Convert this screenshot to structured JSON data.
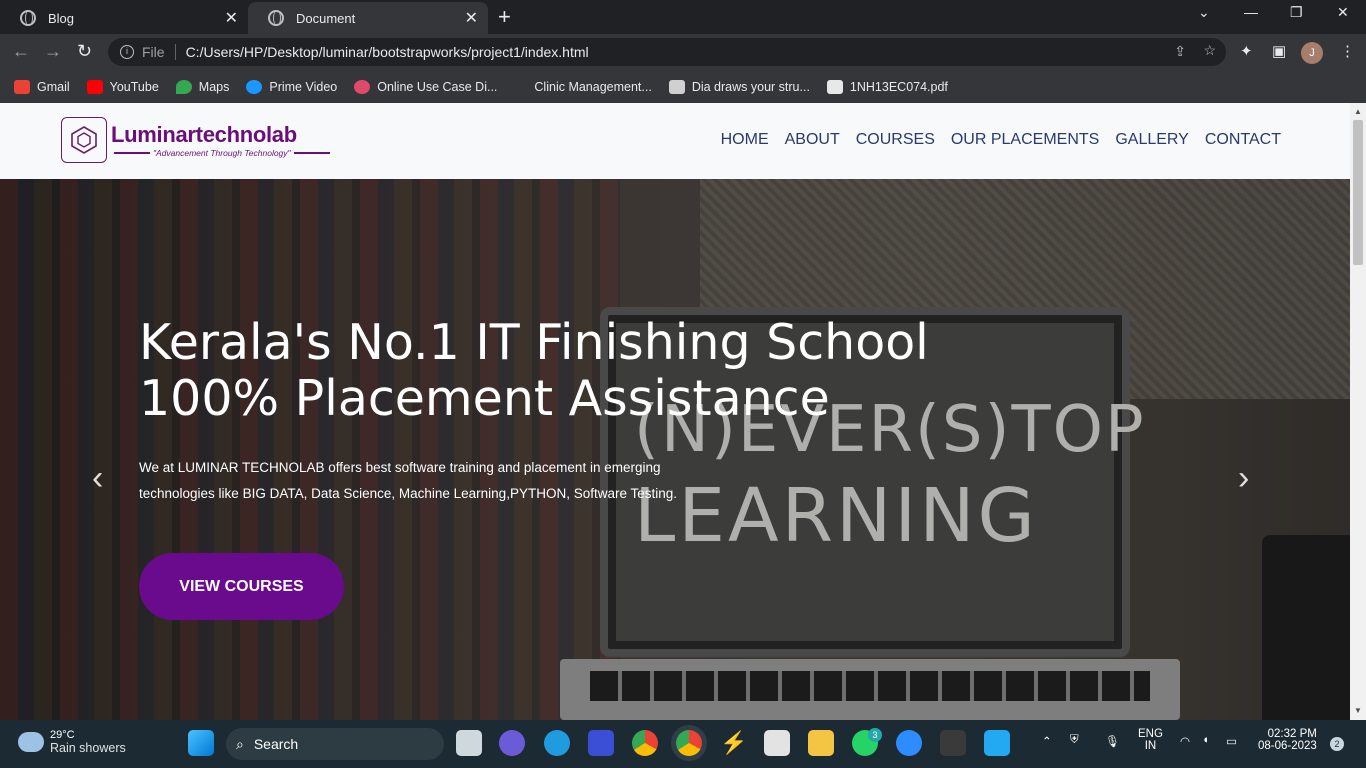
{
  "browser": {
    "tabs": [
      {
        "title": "Blog",
        "active": false
      },
      {
        "title": "Document",
        "active": true
      }
    ],
    "url_scheme_label": "File",
    "url": "C:/Users/HP/Desktop/luminar/bootstrapworks/project1/index.html",
    "profile_initial": "J",
    "bookmarks": [
      {
        "label": "Gmail",
        "icon": "gmail-icon",
        "color": "#ea4335"
      },
      {
        "label": "YouTube",
        "icon": "youtube-icon",
        "color": "#ff0000"
      },
      {
        "label": "Maps",
        "icon": "maps-icon",
        "color": "#34a853"
      },
      {
        "label": "Prime Video",
        "icon": "prime-video-icon",
        "color": "#1a98ff"
      },
      {
        "label": "Online Use Case Di...",
        "icon": "usecase-icon",
        "color": "#e04a6a"
      },
      {
        "label": "Clinic Management...",
        "icon": "blank-icon",
        "color": "#35363a"
      },
      {
        "label": "Dia draws your stru...",
        "icon": "dia-icon",
        "color": "#d0d0d0"
      },
      {
        "label": "1NH13EC074.pdf",
        "icon": "pdf-icon",
        "color": "#e8e8e8"
      }
    ]
  },
  "site": {
    "logo_name": "Luminartechnolab",
    "logo_tagline": "\"Advancement Through Technology\"",
    "nav": [
      "HOME",
      "ABOUT",
      "COURSES",
      "OUR PLACEMENTS",
      "GALLERY",
      "CONTACT"
    ],
    "hero": {
      "heading_line1": "Kerala's No.1 IT Finishing School",
      "heading_line2": "100% Placement Assistance",
      "description_line1": "We at LUMINAR TECHNOLAB offers best software training and placement in emerging",
      "description_line2": "technologies like BIG DATA, Data Science, Machine Learning,PYTHON, Software Testing.",
      "cta_label": "VIEW COURSES",
      "chalk_line1": "(N)EVER(S)TOP",
      "chalk_line2": "LEARNING"
    },
    "accent_color": "#6a0a8c",
    "nav_color": "#283a6e"
  },
  "taskbar": {
    "weather_temp": "29°C",
    "weather_desc": "Rain showers",
    "search_label": "Search",
    "whatsapp_badge": "3",
    "lang_line1": "ENG",
    "lang_line2": "IN",
    "time": "02:32 PM",
    "date": "08-06-2023",
    "notification_count": "2"
  }
}
